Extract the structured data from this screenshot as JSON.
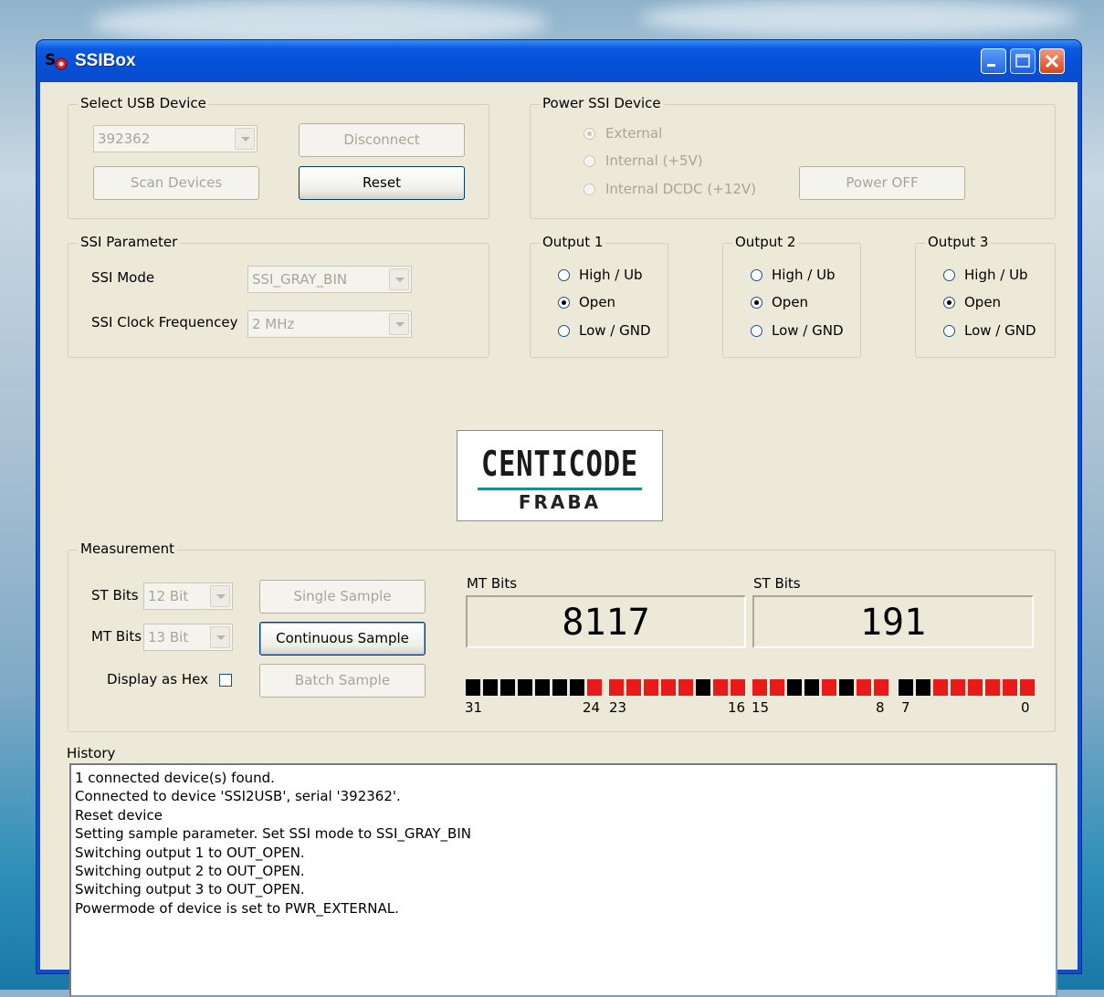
{
  "window": {
    "title": "SSIBox"
  },
  "usb": {
    "group_label": "Select USB Device",
    "device_value": "392362",
    "disconnect_label": "Disconnect",
    "scan_label": "Scan Devices",
    "reset_label": "Reset"
  },
  "power": {
    "group_label": "Power SSI Device",
    "options": [
      "External",
      "Internal (+5V)",
      "Internal DCDC (+12V)"
    ],
    "selected": "External",
    "power_button_label": "Power OFF"
  },
  "ssi": {
    "group_label": "SSI Parameter",
    "mode_label": "SSI Mode",
    "mode_value": "SSI_GRAY_BIN",
    "clock_label": "SSI Clock Frequencey",
    "clock_value": "2 MHz"
  },
  "outputs": [
    {
      "label": "Output 1",
      "options": [
        "High / Ub",
        "Open",
        "Low / GND"
      ],
      "selected": "Open"
    },
    {
      "label": "Output 2",
      "options": [
        "High / Ub",
        "Open",
        "Low / GND"
      ],
      "selected": "Open"
    },
    {
      "label": "Output 3",
      "options": [
        "High / Ub",
        "Open",
        "Low / GND"
      ],
      "selected": "Open"
    }
  ],
  "logo": {
    "main": "CENTICODE",
    "sub": "FRABA"
  },
  "measurement": {
    "group_label": "Measurement",
    "st_bits_label": "ST Bits",
    "st_bits_value": "12 Bit",
    "mt_bits_label": "MT Bits",
    "mt_bits_value": "13 Bit",
    "hex_label": "Display as Hex",
    "hex_checked": false,
    "single_label": "Single Sample",
    "continuous_label": "Continuous Sample",
    "batch_label": "Batch Sample",
    "mt_caption": "MT Bits",
    "mt_value": "8117",
    "st_caption": "ST Bits",
    "st_value": "191",
    "bit_numbers": [
      "31",
      "24",
      "23",
      "16",
      "15",
      "8",
      "7",
      "0"
    ],
    "bits_31_to_0": "00000001111110111100101100111111",
    "bit_colors": {
      "on": "#e81a1a",
      "off": "#000000"
    }
  },
  "history": {
    "label": "History",
    "lines": [
      "1 connected device(s) found.",
      "Connected to device 'SSI2USB', serial '392362'.",
      "Reset device",
      "Setting sample parameter. Set SSI mode to SSI_GRAY_BIN",
      "Switching output 1 to OUT_OPEN.",
      "Switching output 2 to OUT_OPEN.",
      "Switching output 3 to OUT_OPEN.",
      "Powermode of device is set to PWR_EXTERNAL."
    ]
  }
}
